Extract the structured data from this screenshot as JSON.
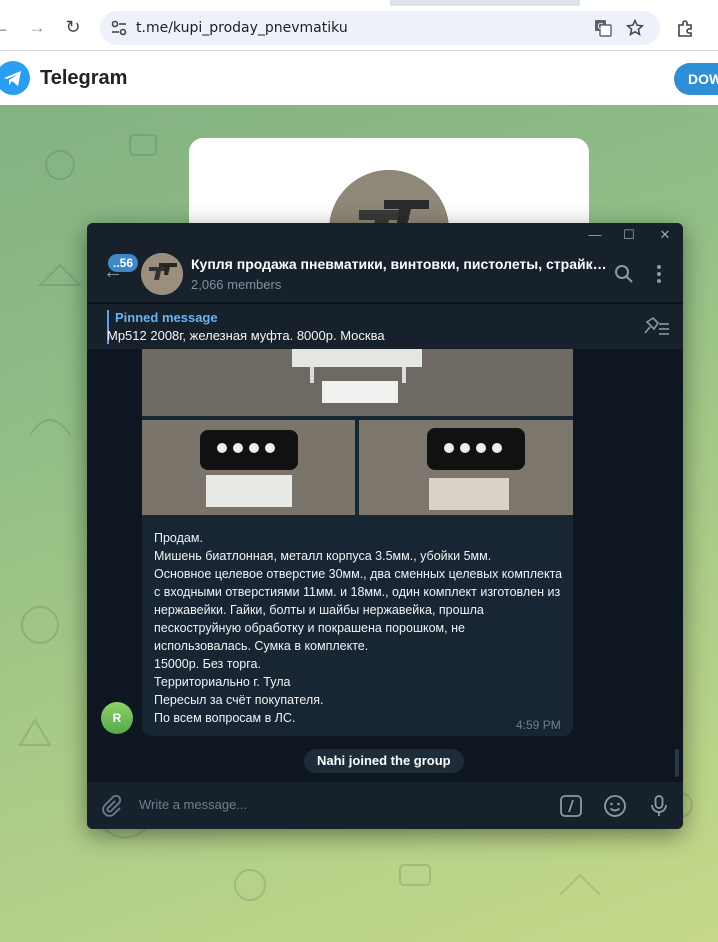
{
  "browser": {
    "url": "t.me/kupi_proday_pnevmatiku",
    "icons": [
      "back-icon",
      "forward-icon",
      "reload-icon",
      "site-settings-icon",
      "translate-icon",
      "bookmark-star-icon",
      "extensions-icon"
    ]
  },
  "telegram_web": {
    "brand": "Telegram",
    "download_label": "DOW",
    "accent": "#2f8fd6"
  },
  "chat": {
    "unread_count": "..56",
    "title": "Купля продажа пневматики, винтовки, пистолеты, страйкбо...",
    "members": "2,066 members",
    "pinned_label": "Pinned message",
    "pinned_text": "Мр512 2008г, железная муфта. 8000р. Москва",
    "message": {
      "sender_initial": "R",
      "text": "Продам.\nМишень биатлонная, металл корпуса 3.5мм., убойки 5мм.\nОсновное целевое отверстие 30мм., два сменных целевых комплекта с входными отверстиями 11мм. и 18мм., один комплект изготовлен из нержавейки. Гайки, болты и шайбы нержавейка, прошла пескоструйную обработку и покрашена порошком, не использовалась. Сумка в комплекте.\n15000р. Без торга.\nТерриториально г. Тула\nПересыл за счёт покупателя.\nПо всем вопросам в ЛС.",
      "time": "4:59 PM"
    },
    "service_message": "Nahi joined the group",
    "composer_placeholder": "Write a message...",
    "colors": {
      "window_bg": "#0e1621",
      "panel_bg": "#17212b",
      "bubble_bg": "#182533",
      "link": "#6ab2f2"
    }
  }
}
